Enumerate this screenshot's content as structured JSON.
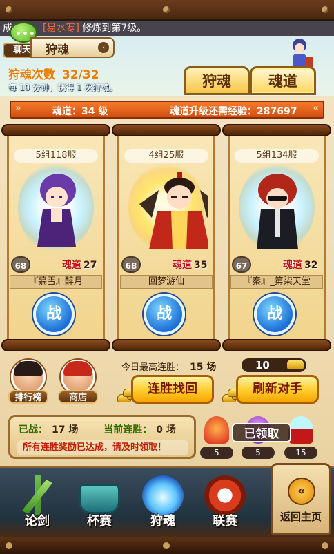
{
  "ticker": {
    "prefix": "成",
    "highlight": "易水寒",
    "message": "修炼到第7级。"
  },
  "chat": {
    "label": "聊天",
    "dots": "•••"
  },
  "header": {
    "title": "狩魂",
    "chevron": "‹"
  },
  "hunt": {
    "label": "狩魂次数",
    "value": "32/32",
    "tip": "每 10 分钟，获得 1 次狩魂。"
  },
  "tabs": [
    {
      "label": "狩魂"
    },
    {
      "label": "魂道"
    }
  ],
  "ribbon": {
    "level": "魂道：34 级",
    "exp_label": "魂道升级还需经验：287697",
    "arrow_left": "»",
    "arrow_right": "«"
  },
  "opponents": [
    {
      "server": "5组118服",
      "level": "68",
      "soul_label": "魂道",
      "soul_value": "27",
      "name": "『慕雪』醉月",
      "fight": "战"
    },
    {
      "server": "4组25服",
      "level": "68",
      "soul_label": "魂道",
      "soul_value": "35",
      "name": "回梦游仙",
      "fight": "战"
    },
    {
      "server": "5组134服",
      "level": "67",
      "soul_label": "魂道",
      "soul_value": "32",
      "name": "『秦』_第柒天堂",
      "fight": "战"
    }
  ],
  "side_buttons": {
    "ranking": "排行榜",
    "shop": "商店"
  },
  "best_streak": {
    "label": "今日最高连胜：",
    "value": "15 场"
  },
  "gold": {
    "value": "10"
  },
  "actions": {
    "recover": "连胜找回",
    "refresh": "刷新对手"
  },
  "stats": {
    "fought_label": "已战：",
    "fought_value": "17 场",
    "streak_label": "当前连胜：",
    "streak_value": "0 场",
    "notice": "所有连胜奖励已达成，请及时领取！"
  },
  "rewards": {
    "items": [
      {
        "count": "5"
      },
      {
        "count": "5"
      },
      {
        "count": "15"
      }
    ],
    "claimed_label": "已领取"
  },
  "nav": [
    {
      "label": "论剑"
    },
    {
      "label": "杯赛"
    },
    {
      "label": "狩魂"
    },
    {
      "label": "联赛"
    }
  ],
  "home": {
    "label": "返回主页",
    "icon": "«"
  }
}
